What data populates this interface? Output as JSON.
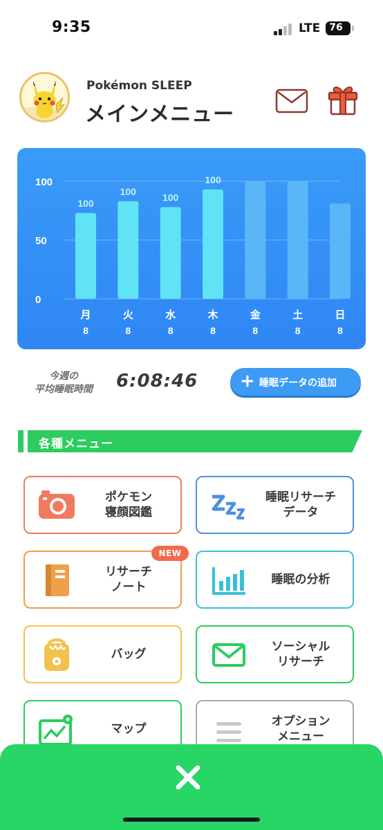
{
  "status_bar": {
    "time": "9:35",
    "network": "LTE",
    "battery": "76"
  },
  "header": {
    "app_name": "Pokémon SLEEP",
    "title": "メインメニュー"
  },
  "chart_data": {
    "type": "bar",
    "categories": [
      "月",
      "火",
      "水",
      "木",
      "金",
      "土",
      "日"
    ],
    "sub_labels": [
      "8",
      "8",
      "8",
      "8",
      "8",
      "8",
      "8"
    ],
    "values": [
      73,
      83,
      78,
      93,
      100,
      100,
      81
    ],
    "data_labels": [
      "100",
      "100",
      "100",
      "100",
      "",
      "",
      ""
    ],
    "highlighted": [
      true,
      true,
      true,
      true,
      false,
      false,
      false
    ],
    "yticks": [
      "0",
      "50",
      "100"
    ],
    "ylim": [
      0,
      100
    ],
    "colors": {
      "highlight": "#5fe3f5",
      "muted": "#5bb6f7"
    }
  },
  "summary": {
    "avg_label_line1": "今週の",
    "avg_label_line2": "平均睡眠時間",
    "avg_value": "6:08:46",
    "add_button": "睡眠データの追加"
  },
  "section": {
    "title": "各種メニュー"
  },
  "menu": [
    {
      "label": "ポケモン\n寝顔図鑑",
      "icon": "camera-icon",
      "color": "#f07a5f"
    },
    {
      "label": "睡眠リサーチ\nデータ",
      "icon": "zzz-icon",
      "color": "#4a90e2"
    },
    {
      "label": "リサーチ\nノート",
      "icon": "notebook-icon",
      "color": "#f0a04b",
      "badge": "NEW"
    },
    {
      "label": "睡眠の分析",
      "icon": "bar-chart-icon",
      "color": "#3bbfd6"
    },
    {
      "label": "バッグ",
      "icon": "bag-icon",
      "color": "#f2c14e"
    },
    {
      "label": "ソーシャル\nリサーチ",
      "icon": "mail-icon",
      "color": "#2ccc5e"
    },
    {
      "label": "マップ",
      "icon": "map-icon",
      "color": "#2ccc5e"
    },
    {
      "label": "オプション\nメニュー",
      "icon": "options-icon",
      "color": "#aaaaaa"
    }
  ],
  "colors": {
    "accent_green": "#27d665",
    "chart_blue": "#2f86f4",
    "button_blue": "#3d9bf5"
  }
}
